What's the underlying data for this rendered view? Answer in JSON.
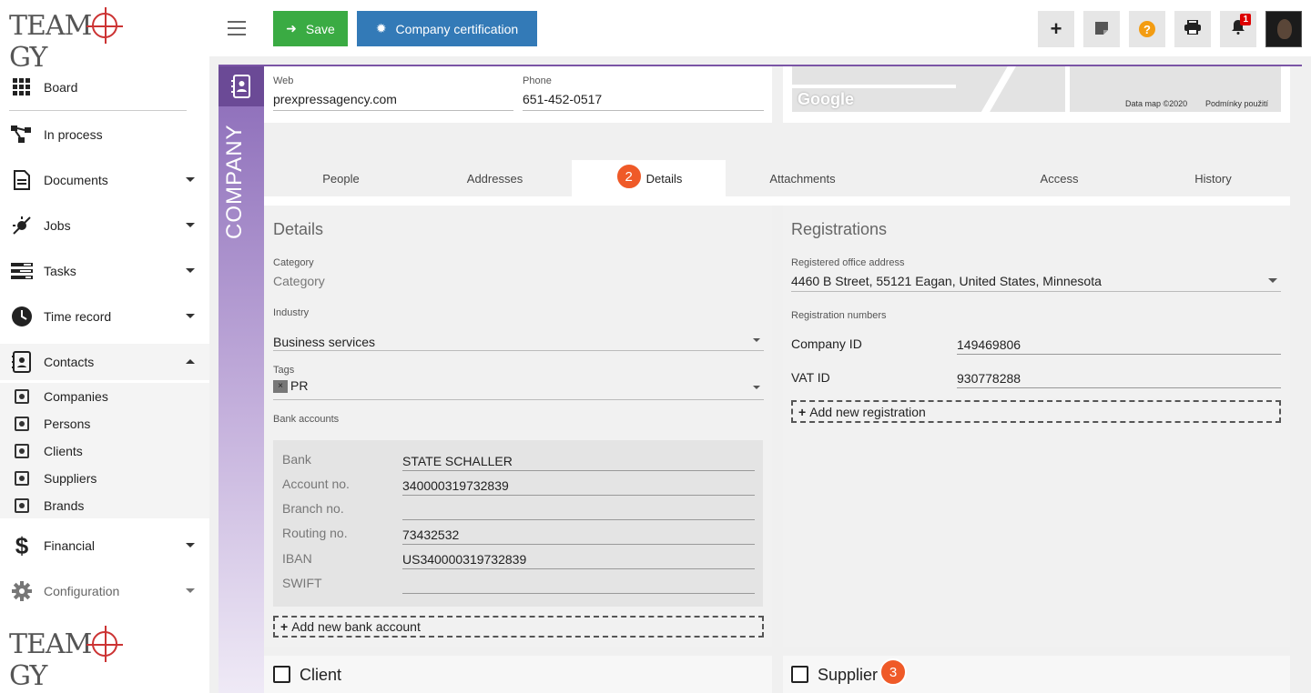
{
  "app": {
    "logo_text": "Teamogy"
  },
  "sidebar": {
    "items": [
      {
        "label": "Board",
        "icon": "grid-icon"
      },
      {
        "label": "In process",
        "icon": "flow-icon"
      },
      {
        "label": "Documents",
        "icon": "document-icon"
      },
      {
        "label": "Jobs",
        "icon": "jobs-icon"
      },
      {
        "label": "Tasks",
        "icon": "tasks-icon"
      },
      {
        "label": "Time record",
        "icon": "clock-icon"
      },
      {
        "label": "Contacts",
        "icon": "contacts-icon"
      },
      {
        "label": "Financial",
        "icon": "dollar-icon"
      },
      {
        "label": "Configuration",
        "icon": "gear-icon"
      }
    ],
    "contacts_sub": [
      "Companies",
      "Persons",
      "Clients",
      "Suppliers",
      "Brands"
    ]
  },
  "toolbar": {
    "save_label": "Save",
    "cert_label": "Company certification",
    "notification_count": "1"
  },
  "company_label": "COMPANY",
  "contact": {
    "web_label": "Web",
    "web_value": "prexpressagency.com",
    "phone_label": "Phone",
    "phone_value": "651-452-0517"
  },
  "map": {
    "brand": "Google",
    "data_text": "Data map ©2020",
    "terms_text": "Podmínky použití"
  },
  "tabs": [
    "People",
    "Addresses",
    "Details",
    "Attachments",
    "Access",
    "History"
  ],
  "active_tab": "Details",
  "steps": {
    "details": "2",
    "supplier": "3"
  },
  "details": {
    "title": "Details",
    "category_label": "Category",
    "category_placeholder": "Category",
    "industry_label": "Industry",
    "industry_value": "Business services",
    "tags_label": "Tags",
    "tag_value": "PR",
    "bank_accounts_label": "Bank accounts",
    "bank": [
      {
        "label": "Bank",
        "value": "STATE SCHALLER"
      },
      {
        "label": "Account no.",
        "value": "340000319732839"
      },
      {
        "label": "Branch no.",
        "value": ""
      },
      {
        "label": "Routing no.",
        "value": "73432532"
      },
      {
        "label": "IBAN",
        "value": "US340000319732839"
      },
      {
        "label": "SWIFT",
        "value": ""
      }
    ],
    "add_bank_label": "Add new bank account"
  },
  "registrations": {
    "title": "Registrations",
    "office_label": "Registered office address",
    "office_value": "4460 B Street, 55121 Eagan, United States, Minnesota",
    "numbers_label": "Registration numbers",
    "company_id_label": "Company ID",
    "company_id_value": "149469806",
    "vat_label": "VAT ID",
    "vat_value": "930778288",
    "add_reg_label": "Add new registration"
  },
  "checks": {
    "client_label": "Client",
    "supplier_label": "Supplier"
  },
  "colors": {
    "save": "#3aab43",
    "cert": "#337ab7",
    "accent": "#7b55a6",
    "step": "#ef5a28"
  }
}
